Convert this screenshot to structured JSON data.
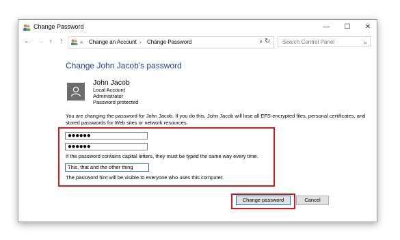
{
  "window": {
    "title": "Change Password",
    "controls": {
      "minimize": "—",
      "maximize": "☐",
      "close": "✕"
    }
  },
  "nav": {
    "back": "←",
    "forward": "→",
    "recent": "∨",
    "up": "↑",
    "address": {
      "overflow": "«",
      "crumbs": [
        "Change an Account",
        "Change Password"
      ],
      "separator": "›",
      "dropdown": "∨"
    },
    "refresh": "↻",
    "search_placeholder": "Search Control Panel"
  },
  "main": {
    "heading": "Change John Jacob's password",
    "user": {
      "name": "John Jacob",
      "details": [
        "Local Account",
        "Administrator",
        "Password protected"
      ]
    },
    "description": "You are changing the password for John Jacob.  If you do this, John Jacob will lose all EFS-encrypted files, personal certificates, and stored passwords for Web sites or network resources.",
    "new_password": "●●●●●●",
    "confirm_password": "●●●●●●",
    "capital_note": "If the password contains capital letters, they must be typed the same way every time.",
    "hint_value": "This, that and the other thing",
    "hint_note": "The password hint will be visible to everyone who uses this computer.",
    "buttons": {
      "change": "Change password",
      "cancel": "Cancel"
    }
  },
  "colors": {
    "heading": "#1f3d9a",
    "highlight": "#d2191e",
    "focus": "#2d6bd6"
  }
}
